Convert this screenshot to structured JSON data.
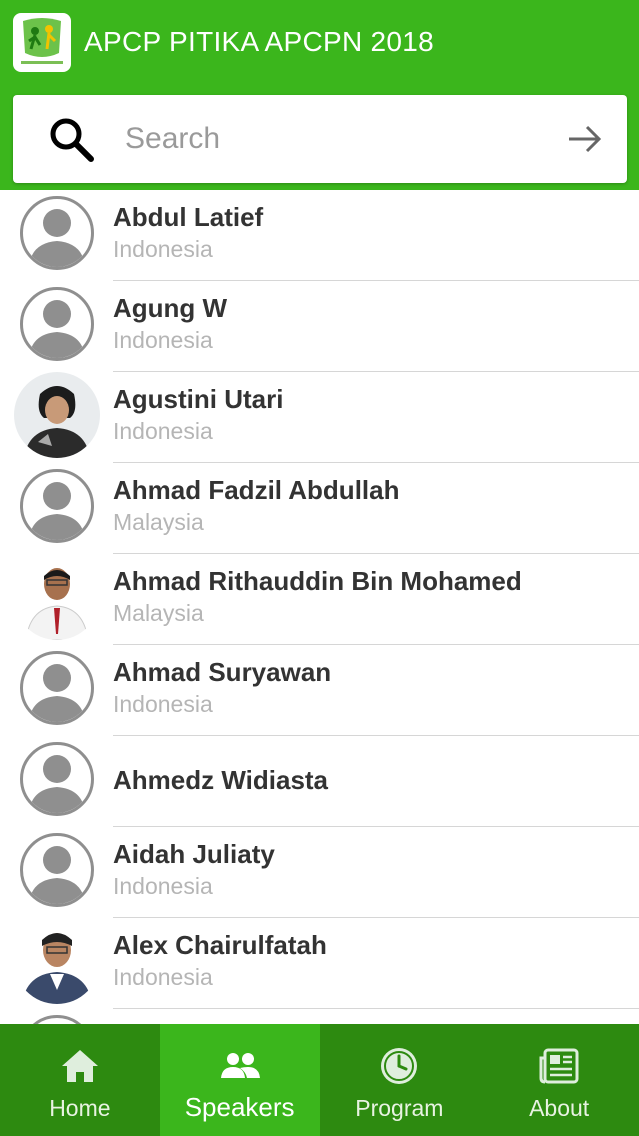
{
  "app": {
    "title": "APCP PITIKA APCPN 2018",
    "colors": {
      "primary": "#3bb61c",
      "dark": "#2d8a10"
    }
  },
  "search": {
    "placeholder": "Search",
    "value": "",
    "icon": "search-icon",
    "submit_icon": "arrow-right-icon"
  },
  "speakers": [
    {
      "name": "Abdul Latief",
      "country": "Indonesia",
      "avatar": "placeholder"
    },
    {
      "name": "Agung W",
      "country": "Indonesia",
      "avatar": "placeholder"
    },
    {
      "name": "Agustini Utari",
      "country": "Indonesia",
      "avatar": "photo"
    },
    {
      "name": "Ahmad Fadzil Abdullah",
      "country": "Malaysia",
      "avatar": "placeholder"
    },
    {
      "name": "Ahmad Rithauddin Bin Mohamed",
      "country": "Malaysia",
      "avatar": "photo"
    },
    {
      "name": "Ahmad Suryawan",
      "country": "Indonesia",
      "avatar": "placeholder"
    },
    {
      "name": "Ahmedz Widiasta",
      "country": "",
      "avatar": "placeholder"
    },
    {
      "name": "Aidah Juliaty",
      "country": "Indonesia",
      "avatar": "placeholder"
    },
    {
      "name": "Alex Chairulfatah",
      "country": "Indonesia",
      "avatar": "photo"
    }
  ],
  "nav": {
    "home": {
      "label": "Home",
      "icon": "home-icon"
    },
    "speakers": {
      "label": "Speakers",
      "icon": "people-icon",
      "active": true
    },
    "program": {
      "label": "Program",
      "icon": "clock-icon"
    },
    "about": {
      "label": "About",
      "icon": "newspaper-icon"
    }
  }
}
